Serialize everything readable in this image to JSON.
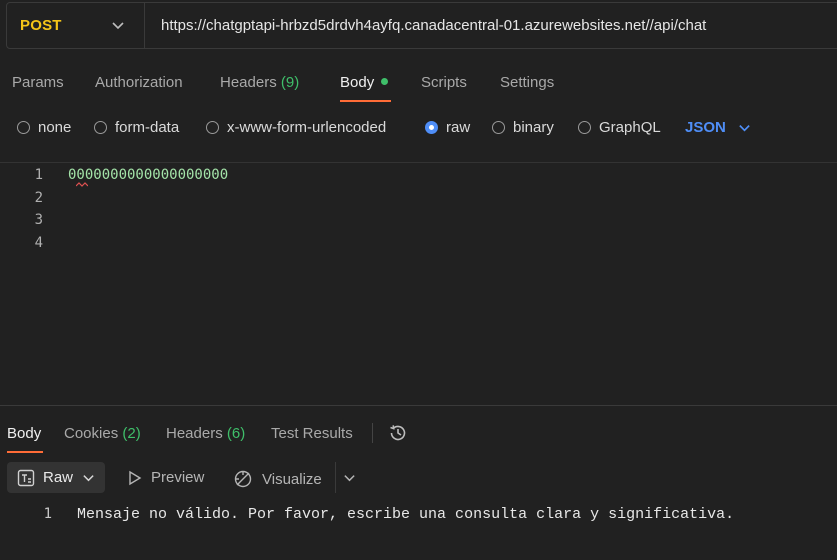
{
  "request": {
    "method": "POST",
    "url": "https://chatgptapi-hrbzd5drdvh4ayfq.canadacentral-01.azurewebsites.net//api/chat"
  },
  "request_tabs": {
    "params": "Params",
    "authorization": "Authorization",
    "headers": "Headers",
    "headers_count": "(9)",
    "body": "Body",
    "scripts": "Scripts",
    "settings": "Settings"
  },
  "body_types": {
    "none": "none",
    "form_data": "form-data",
    "urlencoded": "x-www-form-urlencoded",
    "raw": "raw",
    "binary": "binary",
    "graphql": "GraphQL",
    "selected": "raw",
    "format": "JSON"
  },
  "editor": {
    "line_numbers": [
      "1",
      "2",
      "3",
      "4"
    ],
    "lines": [
      "0000000000000000000",
      "",
      "",
      ""
    ]
  },
  "response_tabs": {
    "body": "Body",
    "cookies": "Cookies",
    "cookies_count": "(2)",
    "headers": "Headers",
    "headers_count": "(6)",
    "test_results": "Test Results"
  },
  "response_toolbar": {
    "raw": "Raw",
    "preview": "Preview",
    "visualize": "Visualize"
  },
  "response_body": {
    "line_number": "1",
    "text": "Mensaje no válido. Por favor, escribe una consulta clara y significativa."
  },
  "colors": {
    "accent_orange": "#ff6c37",
    "method_yellow": "#f5c518",
    "link_blue": "#4f8ef7",
    "count_green": "#3fbf6a"
  }
}
